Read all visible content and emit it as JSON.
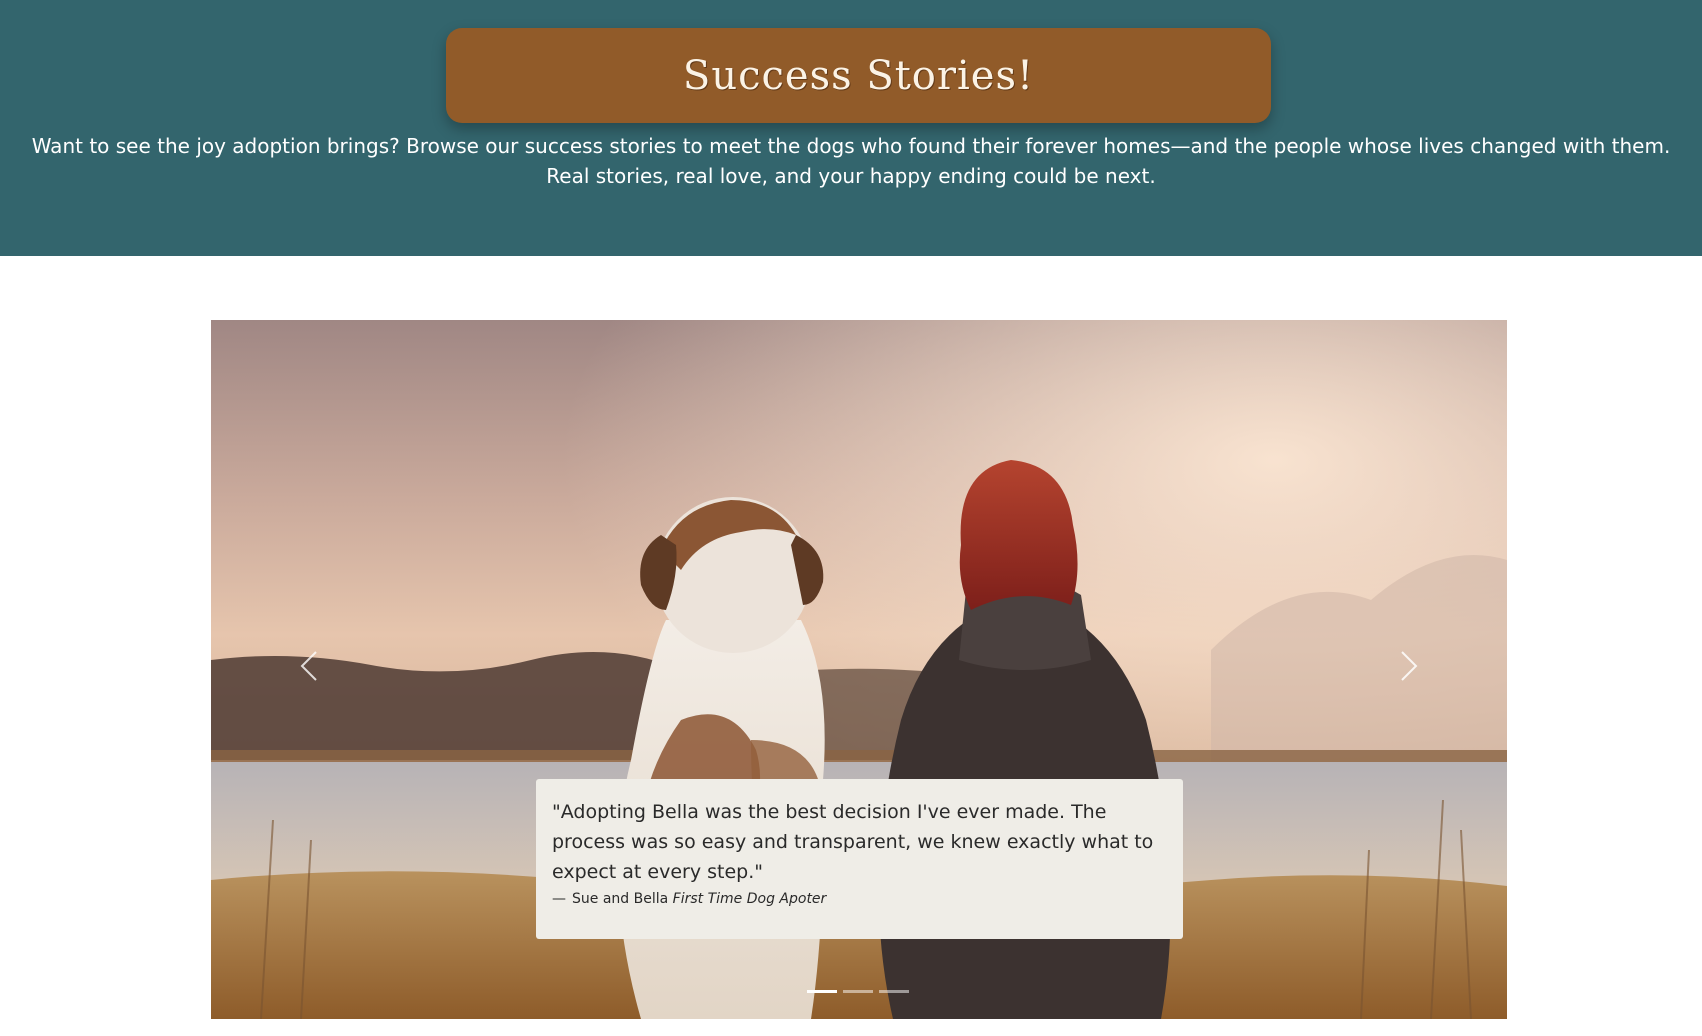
{
  "header": {
    "title": "Success Stories!",
    "intro": "Want to see the joy adoption brings? Browse our success stories to meet the dogs who found their forever homes—and the people whose lives changed with them. Real stories, real love, and your happy ending could be next."
  },
  "carousel": {
    "slide_count": 3,
    "active_index": 0,
    "prev_icon": "chevron-left-icon",
    "next_icon": "chevron-right-icon",
    "quote": {
      "text": "\"Adopting Bella was the best decision I've ever made. The process was so easy and transparent, we knew exactly what to expect at every step.\"",
      "dash": "—",
      "author": "Sue and Bella",
      "role": "First Time Dog Apoter"
    }
  },
  "colors": {
    "hero_bg": "#33656d",
    "title_pill": "#915b29",
    "card_bg": "#efede7"
  }
}
